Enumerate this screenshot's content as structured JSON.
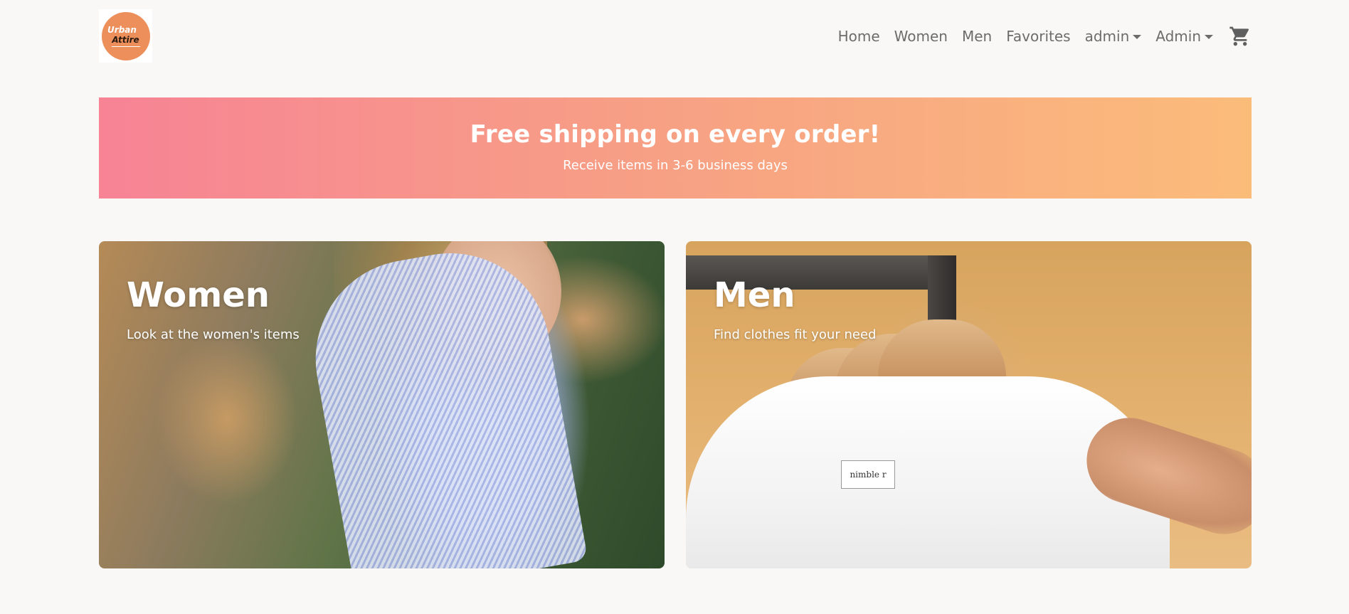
{
  "brand": {
    "logo_line1": "Urban",
    "logo_line2": "Attire"
  },
  "nav": {
    "home": "Home",
    "women": "Women",
    "men": "Men",
    "favorites": "Favorites",
    "user_menu": "admin",
    "admin_menu": "Admin",
    "cart_icon": "shopping-cart-icon"
  },
  "banner": {
    "title": "Free shipping on every order!",
    "subtitle": "Receive items in 3-6 business days",
    "gradient_start": "#f78395",
    "gradient_end": "#fbbc7a"
  },
  "categories": [
    {
      "title": "Women",
      "subtitle": "Look at the women's items"
    },
    {
      "title": "Men",
      "subtitle": "Find clothes fit your need",
      "shirt_label": "nimble r"
    }
  ]
}
